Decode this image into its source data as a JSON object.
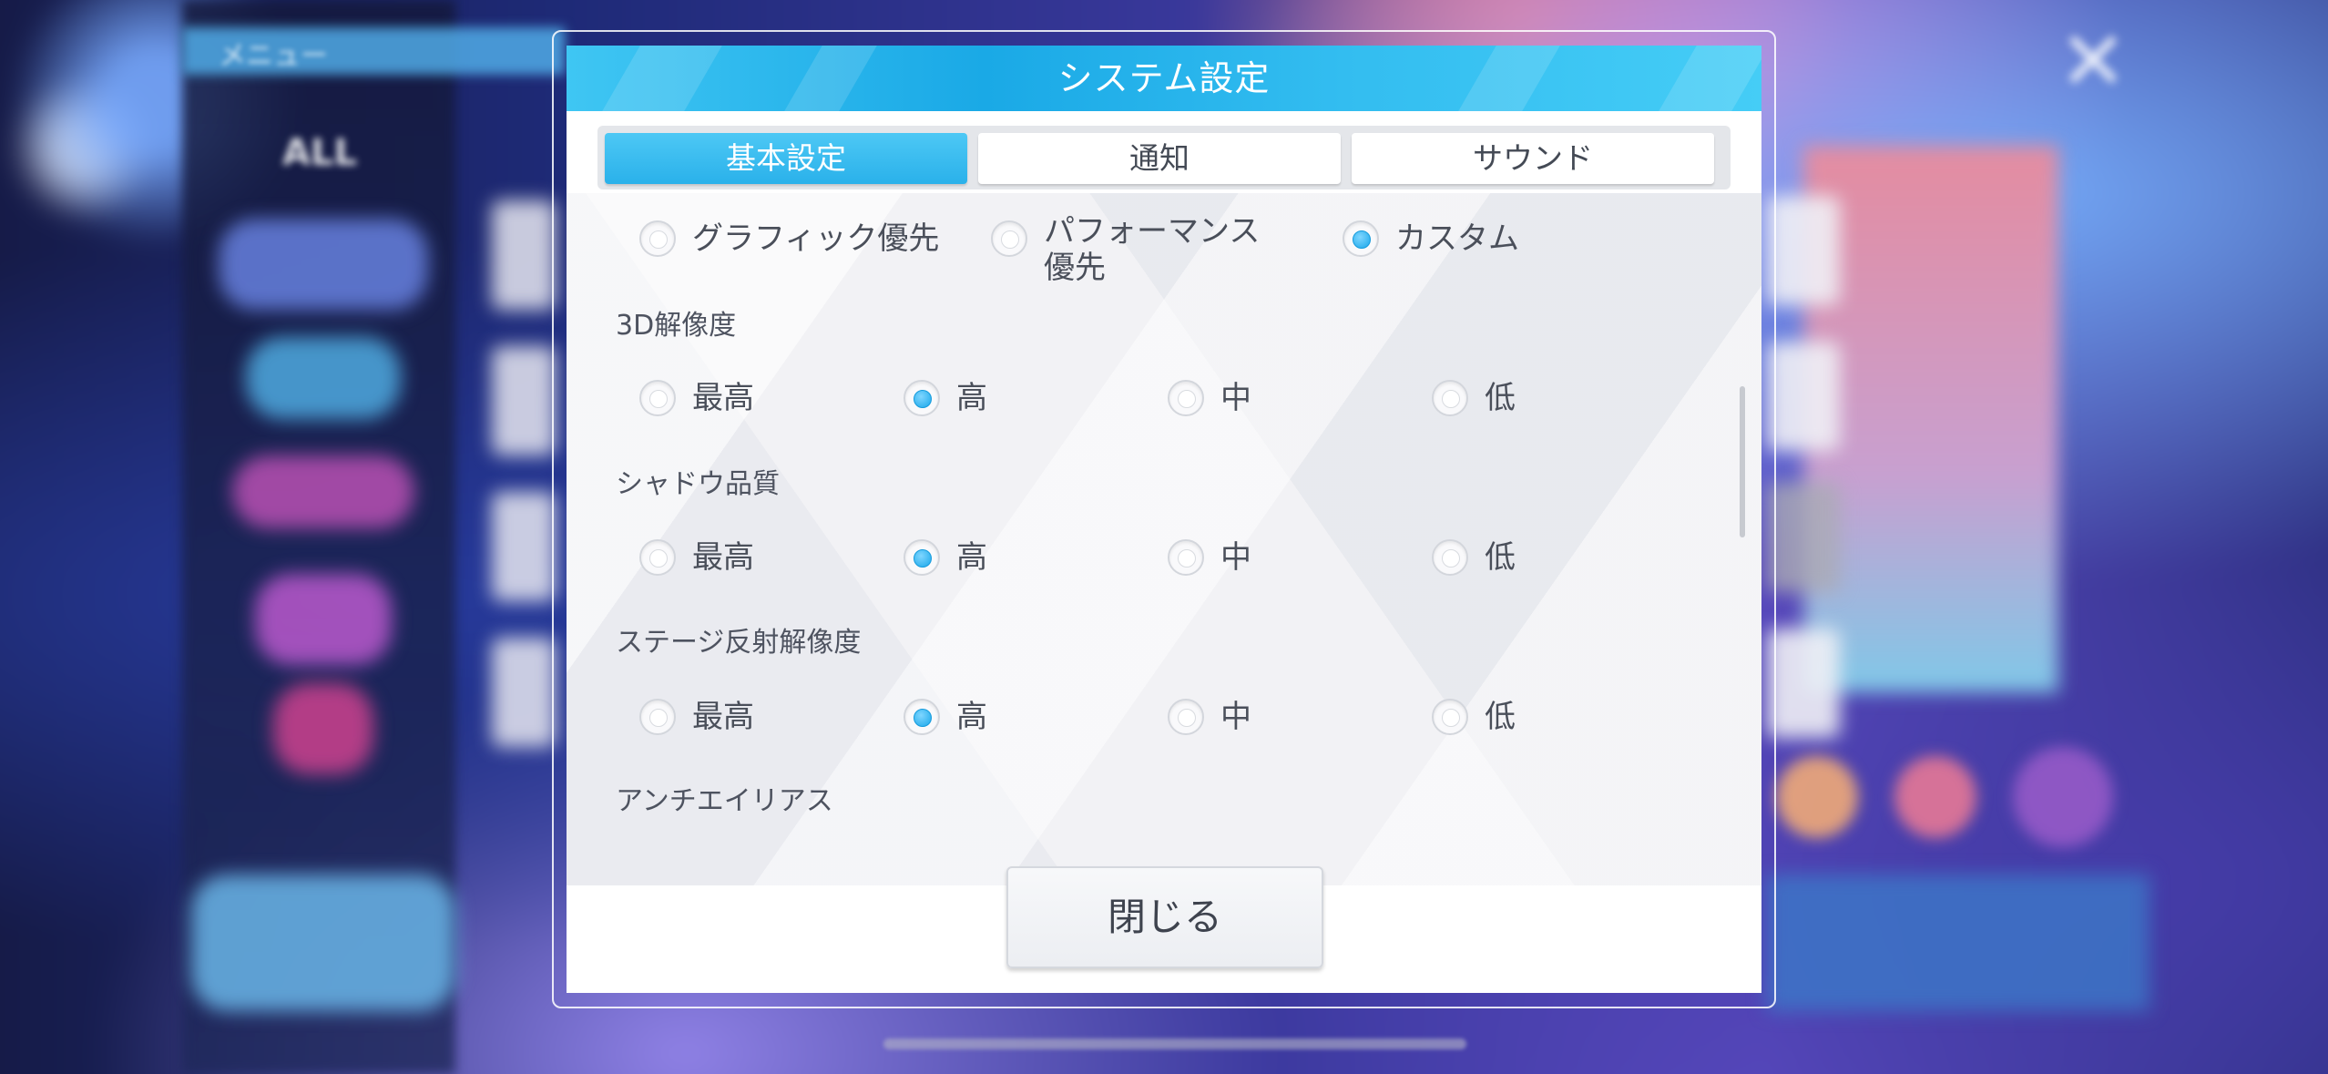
{
  "background": {
    "menu_label": "メニュー",
    "all_label": "ALL"
  },
  "dialog": {
    "title": "システム設定",
    "tabs": [
      {
        "label": "基本設定",
        "active": true
      },
      {
        "label": "通知",
        "active": false
      },
      {
        "label": "サウンド",
        "active": false
      }
    ],
    "preset": {
      "options": [
        {
          "label": "グラフィック優先",
          "selected": false
        },
        {
          "label": "パフォーマンス\n優先",
          "selected": false
        },
        {
          "label": "カスタム",
          "selected": true
        }
      ]
    },
    "resolution_3d": {
      "label": "3D解像度",
      "options": [
        {
          "label": "最高",
          "selected": false
        },
        {
          "label": "高",
          "selected": true
        },
        {
          "label": "中",
          "selected": false
        },
        {
          "label": "低",
          "selected": false
        }
      ]
    },
    "shadow_quality": {
      "label": "シャドウ品質",
      "options": [
        {
          "label": "最高",
          "selected": false
        },
        {
          "label": "高",
          "selected": true
        },
        {
          "label": "中",
          "selected": false
        },
        {
          "label": "低",
          "selected": false
        }
      ]
    },
    "stage_reflection": {
      "label": "ステージ反射解像度",
      "options": [
        {
          "label": "最高",
          "selected": false
        },
        {
          "label": "高",
          "selected": true
        },
        {
          "label": "中",
          "selected": false
        },
        {
          "label": "低",
          "selected": false
        }
      ]
    },
    "anti_aliasing": {
      "label": "アンチエイリアス"
    },
    "close_label": "閉じる"
  },
  "colors": {
    "accent": "#2ab1ea",
    "title_bar": "#1aa9e6",
    "radio_selected": "#1aa7ea"
  }
}
